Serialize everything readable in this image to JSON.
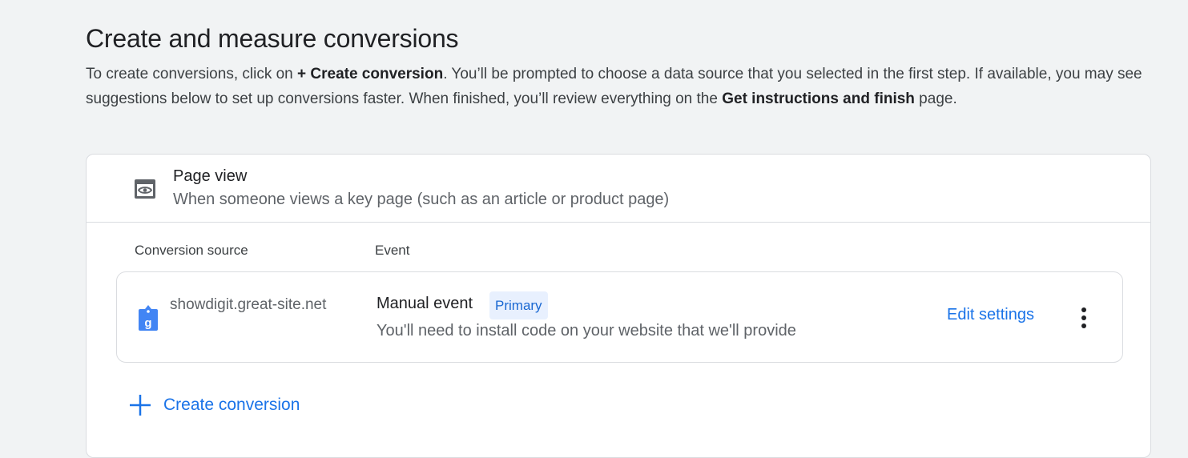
{
  "page": {
    "title": "Create and measure conversions",
    "intro": {
      "part1": "To create conversions, click on ",
      "bold1": "+ Create conversion",
      "part2": ". You’ll be prompted to choose a data source that you selected in the first step. If available, you may see suggestions below to set up conversions faster. When finished, you’ll review everything on the ",
      "bold2": "Get instructions and finish",
      "part3": " page."
    }
  },
  "card": {
    "header": {
      "icon": "page-view-eye-icon",
      "title": "Page view",
      "subtitle": "When someone views a key page (such as an article or product page)"
    },
    "columns": {
      "source": "Conversion source",
      "event": "Event"
    },
    "rows": [
      {
        "source_icon": "google-tag-icon",
        "source": "showdigit.great-site.net",
        "event_name": "Manual event",
        "badge": "Primary",
        "event_desc": "You'll need to install code on your website that we'll provide",
        "edit_label": "Edit settings",
        "more_icon": "more-vert-icon"
      }
    ],
    "create": {
      "icon": "plus-icon",
      "label": "Create conversion"
    }
  },
  "colors": {
    "accent": "#1a73e8",
    "badge_bg": "#e8f0fe",
    "badge_text": "#1967d2",
    "background": "#f1f3f4"
  }
}
